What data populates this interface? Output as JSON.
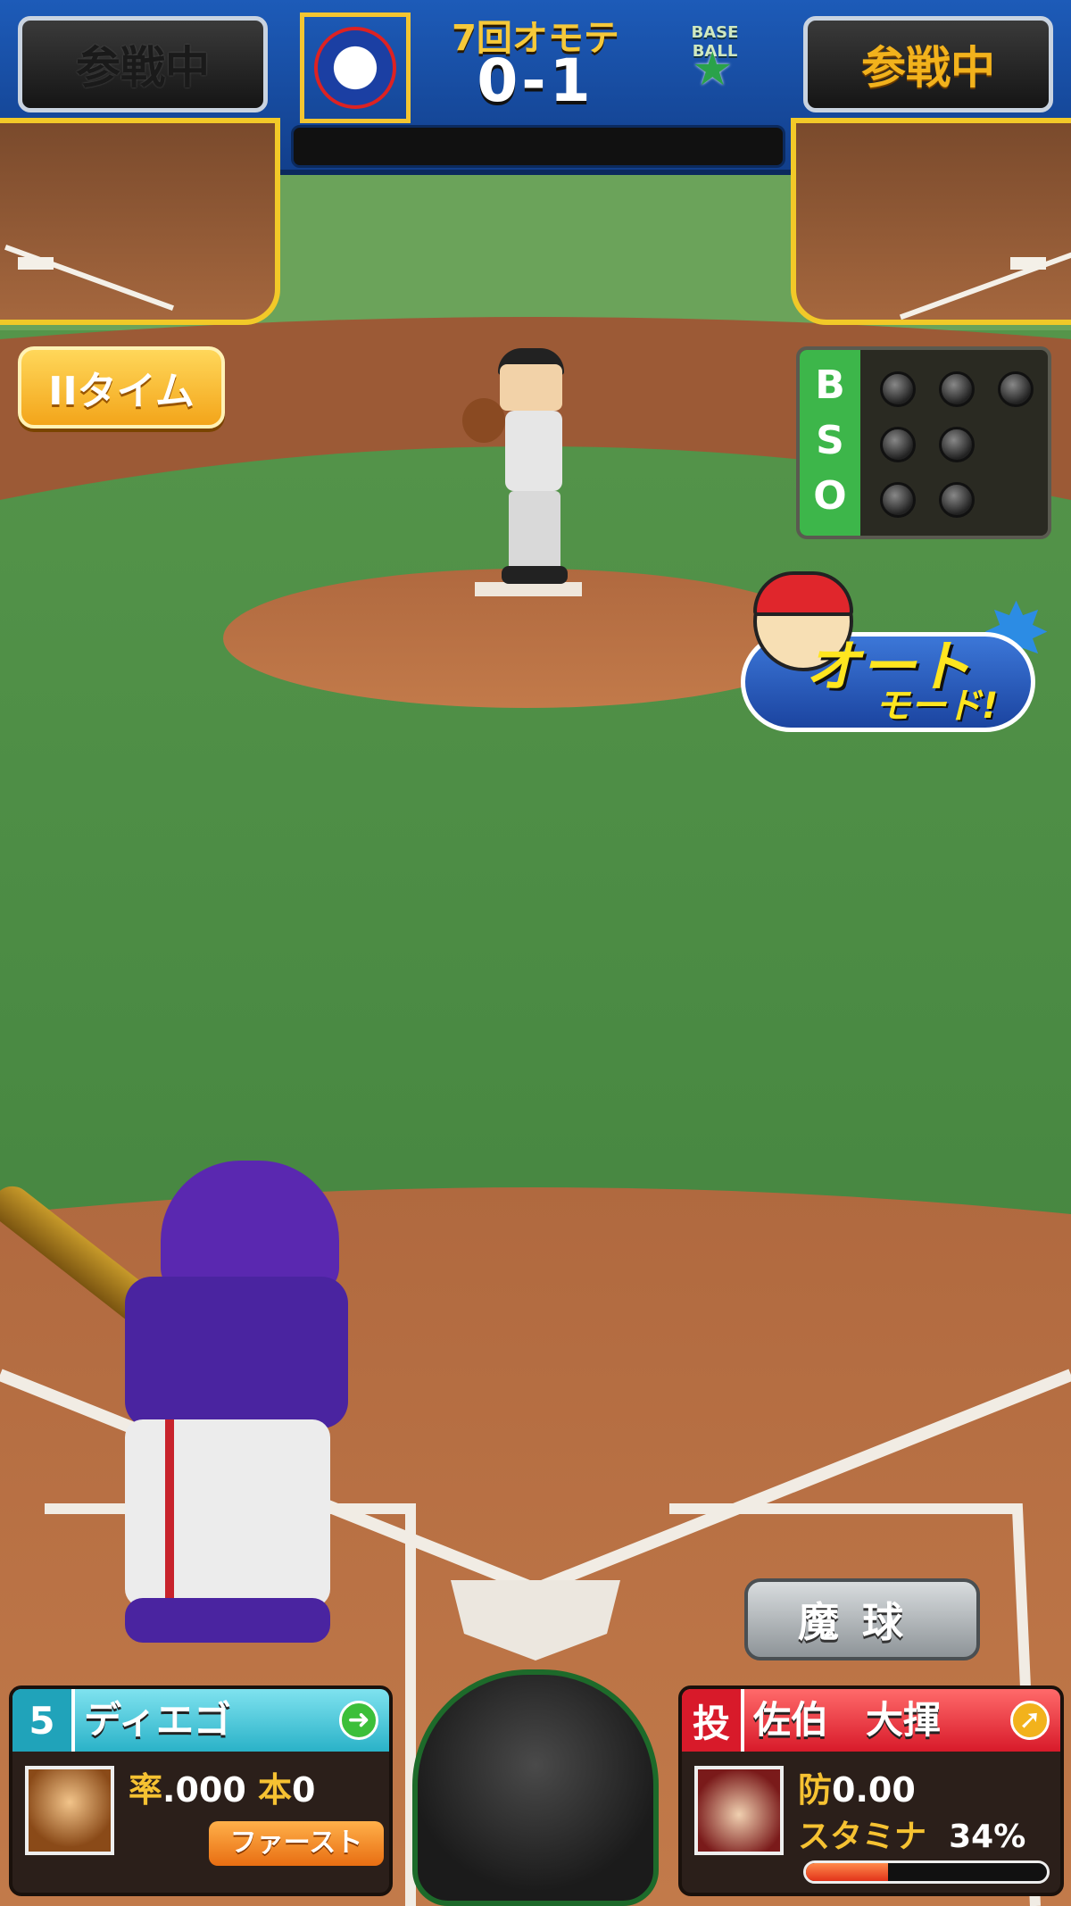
{
  "hud": {
    "left_status": "参戦中",
    "right_status": "参戦中",
    "inning": "7回オモテ",
    "score": "0-1",
    "away_logo_text": "BASE BALL",
    "home_logo_text": "BASE BALL"
  },
  "controls": {
    "time_label": "IIタイム",
    "magic_pitch_label": "魔球",
    "auto_mode_line1": "オート",
    "auto_mode_line2": "モード!"
  },
  "count": {
    "labels": [
      "B",
      "S",
      "O"
    ],
    "balls": 0,
    "strikes": 0,
    "outs": 0,
    "max_balls": 3,
    "max_strikes": 2,
    "max_outs": 2
  },
  "batter": {
    "order": "5",
    "name": "ディエゴ",
    "avg_label": "率",
    "avg_value": ".000",
    "hr_label": "本",
    "hr_value": "0",
    "position": "ファースト"
  },
  "pitcher": {
    "tag": "投",
    "name": "佐伯　大揮",
    "era_label": "防",
    "era_value": "0.00",
    "stamina_label": "スタミナ",
    "stamina_value": "34%",
    "stamina_fraction": 0.34
  },
  "colors": {
    "hud_blue": "#1d5bb8",
    "gold": "#f2b21c",
    "bso_green": "#3db64a",
    "batter_panel": "#2ab2c8",
    "pitcher_panel": "#d81a2a"
  }
}
